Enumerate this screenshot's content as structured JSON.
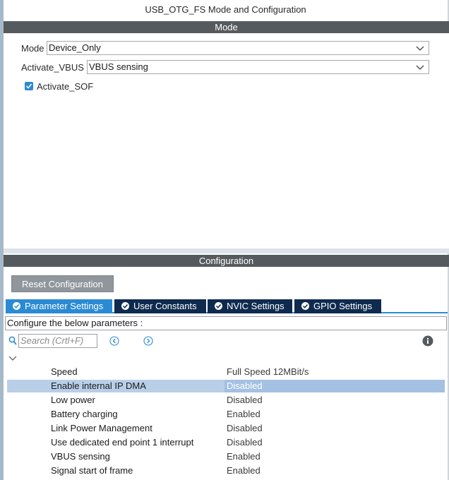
{
  "window": {
    "title": "USB_OTG_FS Mode and Configuration"
  },
  "mode_section": {
    "header": "Mode",
    "fields": [
      {
        "label": "Mode",
        "value": "Device_Only"
      },
      {
        "label": "Activate_VBUS",
        "value": "VBUS sensing"
      }
    ],
    "checkbox": {
      "label": "Activate_SOF",
      "checked": true
    }
  },
  "config_section": {
    "header": "Configuration",
    "reset_button": "Reset Configuration",
    "tabs": [
      {
        "label": "Parameter Settings",
        "active": true
      },
      {
        "label": "User Constants",
        "active": false
      },
      {
        "label": "NVIC Settings",
        "active": false
      },
      {
        "label": "GPIO Settings",
        "active": false
      }
    ],
    "configure_text": "Configure the below parameters :",
    "search_placeholder": "Search (Crtl+F)",
    "parameters": [
      {
        "name": "Speed",
        "value": "Full Speed 12MBit/s",
        "selected": false
      },
      {
        "name": "Enable internal IP DMA",
        "value": "Disabled",
        "selected": true
      },
      {
        "name": "Low power",
        "value": "Disabled",
        "selected": false
      },
      {
        "name": "Battery charging",
        "value": "Enabled",
        "selected": false
      },
      {
        "name": "Link Power Management",
        "value": "Disabled",
        "selected": false
      },
      {
        "name": "Use dedicated end point 1 interrupt",
        "value": "Disabled",
        "selected": false
      },
      {
        "name": "VBUS sensing",
        "value": "Enabled",
        "selected": false
      },
      {
        "name": "Signal start of frame",
        "value": "Enabled",
        "selected": false
      }
    ]
  },
  "colors": {
    "section_bar": "#555a5e",
    "tab_active": "#2a8ad4",
    "tab_inactive": "#0e2b4f",
    "selected_row": "#b9cfe8"
  }
}
